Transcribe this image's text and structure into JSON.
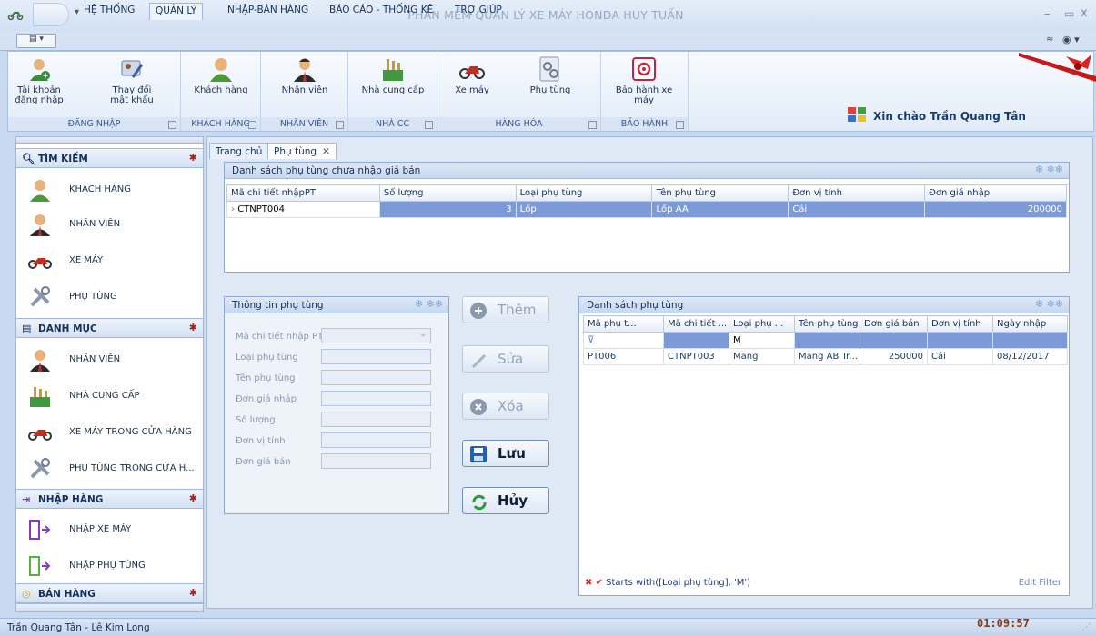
{
  "window": {
    "title": "PHẦN MỀM QUẢN LÝ XE MÁY HONDA HUY TUẤN",
    "minimize": "–",
    "maximize": "▭",
    "close": "x"
  },
  "menu": {
    "tabs": [
      "HỆ THỐNG",
      "QUẢN LÝ",
      "NHẬP-BÁN HÀNG",
      "BÁO CÁO - THỐNG KÊ",
      "TRỢ GIÚP"
    ],
    "active": "QUẢN LÝ"
  },
  "ribbon": {
    "groups": [
      {
        "label": "ĐĂNG NHẬP",
        "buttons": [
          "Tài khoản đăng nhập",
          "Thay đổi mật khẩu"
        ]
      },
      {
        "label": "KHÁCH HÀNG",
        "buttons": [
          "Khách hàng"
        ]
      },
      {
        "label": "NHÂN VIÊN",
        "buttons": [
          "Nhân viên"
        ]
      },
      {
        "label": "NHÀ CC",
        "buttons": [
          "Nhà cung cấp"
        ]
      },
      {
        "label": "HÀNG HÓA",
        "buttons": [
          "Xe máy",
          "Phụ tùng"
        ]
      },
      {
        "label": "BẢO HÀNH",
        "buttons": [
          "Bảo hành xe máy"
        ]
      }
    ],
    "welcome": "Xin chào Trần Quang Tân"
  },
  "sidebar": {
    "sections": [
      {
        "title": "TÌM KIẾM",
        "items": [
          "KHÁCH HÀNG",
          "NHÂN VIÊN",
          "XE MÁY",
          "PHỤ TÙNG"
        ]
      },
      {
        "title": "DANH MỤC",
        "items": [
          "NHÂN VIÊN",
          "NHÀ CUNG CẤP",
          "XE MÁY TRONG CỬA HÀNG",
          "PHỤ TÙNG TRONG CỬA H..."
        ]
      },
      {
        "title": "NHẬP HÀNG",
        "items": [
          "NHẬP XE MÁY",
          "NHẬP PHỤ TÙNG"
        ]
      },
      {
        "title": "BÁN HÀNG",
        "items": []
      }
    ]
  },
  "doc_tabs": [
    "Trang chủ",
    "Phụ tùng"
  ],
  "top_panel": {
    "title": "Danh sách phụ tùng chưa nhập giá bán",
    "columns": [
      "Mã chi tiết nhậpPT",
      "Số lượng",
      "Loại phụ tùng",
      "Tên phụ tùng",
      "Đơn vị tính",
      "Đơn giá nhập"
    ],
    "rows": [
      [
        "CTNPT004",
        "3",
        "Lốp",
        "Lốp AA",
        "Cái",
        "200000"
      ]
    ]
  },
  "form_panel": {
    "title": "Thông tin phụ tùng",
    "fields": [
      "Mã chi tiết nhập PT",
      "Loại phụ tùng",
      "Tên phụ tùng",
      "Đơn giá nhập",
      "Số lượng",
      "Đơn vị tính",
      "Đơn giá bán"
    ]
  },
  "actions": [
    "Thêm",
    "Sửa",
    "Xóa",
    "Lưu",
    "Hủy"
  ],
  "list_panel": {
    "title": "Danh sách phụ tùng",
    "columns": [
      "Mã phụ t...",
      "Mã chi tiết ...",
      "Loại phụ ...",
      "Tên phụ tùng",
      "Đơn giá bán",
      "Đơn vị tính",
      "Ngày nhập"
    ],
    "filter_value": "M",
    "rows": [
      [
        "PT006",
        "CTNPT003",
        "Mang",
        "Mang AB Tr...",
        "250000",
        "Cái",
        "08/12/2017"
      ]
    ],
    "filter_text": "Starts with([Loại phụ tùng], 'M')",
    "edit_filter": "Edit Filter"
  },
  "status": {
    "users": "Trần Quang Tân - Lê Kim Long",
    "clock": "01:09:57"
  }
}
